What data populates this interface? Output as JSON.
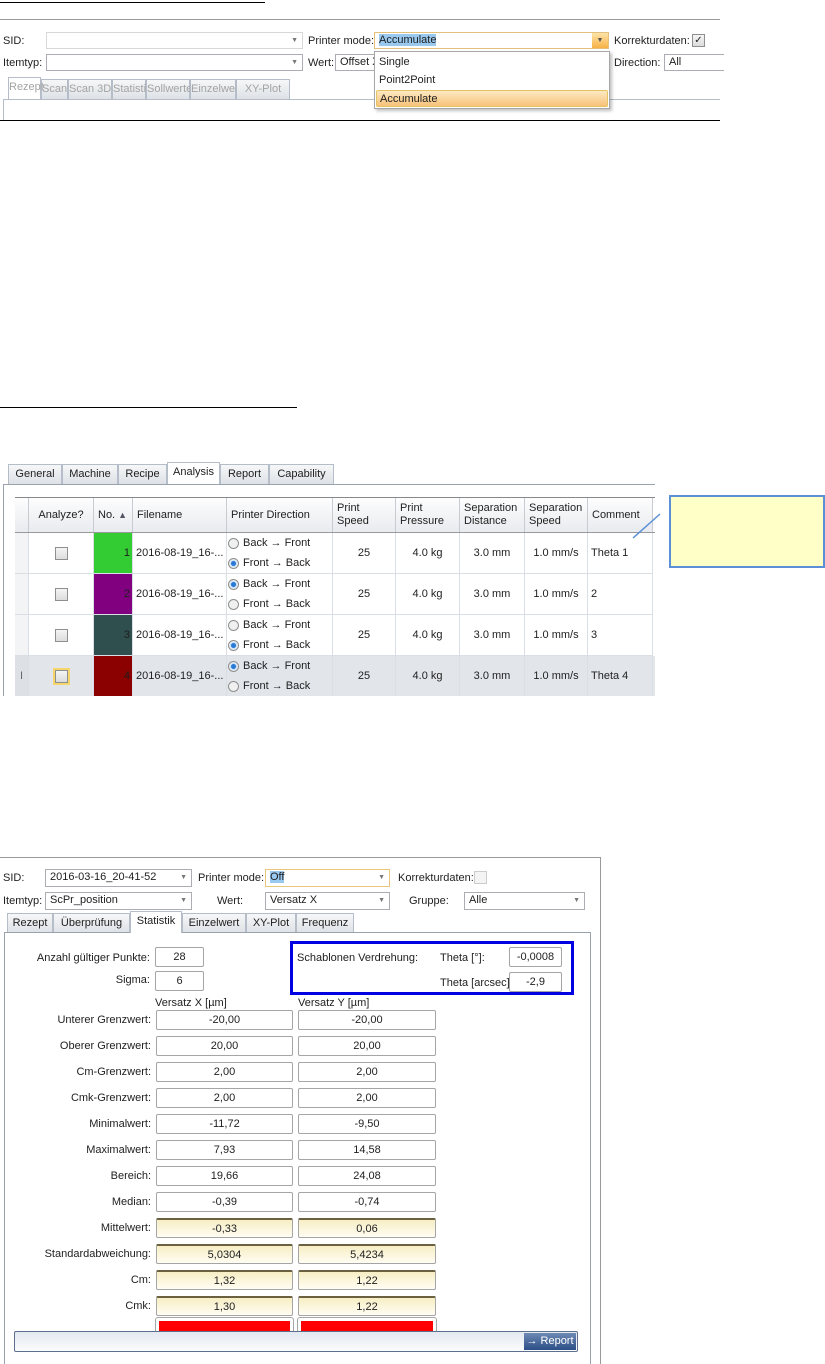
{
  "panel1": {
    "sid_label": "SID:",
    "sid_value": "",
    "printer_mode_label": "Printer mode:",
    "printer_mode_value": "Accumulate",
    "korrektur_label": "Korrekturdaten:",
    "korrektur_checked": true,
    "itemtyp_label": "Itemtyp:",
    "itemtyp_value": "",
    "wert_label": "Wert:",
    "wert_value": "Offset X",
    "direction_label": "Direction:",
    "direction_value": "All",
    "dropdown_options": [
      "Single",
      "Point2Point",
      "Accumulate"
    ],
    "tabs": [
      "Rezept",
      "Scan",
      "Scan 3D",
      "Statistik",
      "Sollwerte",
      "Einzelwert",
      "XY-Plot"
    ]
  },
  "panel2": {
    "tabs": [
      "General",
      "Machine",
      "Recipe",
      "Analysis",
      "Report",
      "Capability"
    ],
    "columns": [
      "Analyze?",
      "No.",
      "Filename",
      "Printer Direction",
      "Print Speed",
      "Print Pressure",
      "Separation Distance",
      "Separation Speed",
      "Comment"
    ],
    "direction_options": [
      "Back → Front",
      "Front → Back"
    ],
    "rows": [
      {
        "no": "1",
        "color": "#33cc33",
        "filename": "2016-08-19_16-...",
        "direction": 1,
        "speed": "25",
        "pressure": "4.0 kg",
        "distance": "3.0 mm",
        "sep_speed": "1.0 mm/s",
        "comment": "Theta 1"
      },
      {
        "no": "2",
        "color": "#800080",
        "filename": "2016-08-19_16-...",
        "direction": 0,
        "speed": "25",
        "pressure": "4.0 kg",
        "distance": "3.0 mm",
        "sep_speed": "1.0 mm/s",
        "comment": "2"
      },
      {
        "no": "3",
        "color": "#2f4f4f",
        "filename": "2016-08-19_16-...",
        "direction": 1,
        "speed": "25",
        "pressure": "4.0 kg",
        "distance": "3.0 mm",
        "sep_speed": "1.0 mm/s",
        "comment": "3"
      },
      {
        "no": "4",
        "color": "#8b0000",
        "filename": "2016-08-19_16-...",
        "direction": 0,
        "speed": "25",
        "pressure": "4.0 kg",
        "distance": "3.0 mm",
        "sep_speed": "1.0 mm/s",
        "comment": "Theta 4"
      }
    ]
  },
  "panel3": {
    "sid_label": "SID:",
    "sid_value": "2016-03-16_20-41-52",
    "printer_mode_label": "Printer mode:",
    "printer_mode_value": "Off",
    "korrektur_label": "Korrekturdaten:",
    "korrektur_checked": false,
    "itemtyp_label": "Itemtyp:",
    "itemtyp_value": "ScPr_position",
    "wert_label": "Wert:",
    "wert_value": "Versatz X",
    "gruppe_label": "Gruppe:",
    "gruppe_value": "Alle",
    "tabs": [
      "Rezept",
      "Überprüfung",
      "Statistik",
      "Einzelwert",
      "XY-Plot",
      "Frequenz"
    ],
    "anzahl_label": "Anzahl gültiger Punkte:",
    "anzahl_value": "28",
    "sigma_label": "Sigma:",
    "sigma_value": "6",
    "verdrehung_label": "Schablonen Verdrehung:",
    "theta_deg_label": "Theta [°]:",
    "theta_deg_value": "-0,0008",
    "theta_arcsec_label": "Theta [arcsec]:",
    "theta_arcsec_value": "-2,9",
    "col_x": "Versatz X [µm]",
    "col_y": "Versatz Y [µm]",
    "stats": [
      {
        "label": "Unterer Grenzwert:",
        "x": "-20,00",
        "y": "-20,00",
        "style": ""
      },
      {
        "label": "Oberer Grenzwert:",
        "x": "20,00",
        "y": "20,00",
        "style": ""
      },
      {
        "label": "Cm-Grenzwert:",
        "x": "2,00",
        "y": "2,00",
        "style": ""
      },
      {
        "label": "Cmk-Grenzwert:",
        "x": "2,00",
        "y": "2,00",
        "style": ""
      },
      {
        "label": "Minimalwert:",
        "x": "-11,72",
        "y": "-9,50",
        "style": ""
      },
      {
        "label": "Maximalwert:",
        "x": "7,93",
        "y": "14,58",
        "style": ""
      },
      {
        "label": "Bereich:",
        "x": "19,66",
        "y": "24,08",
        "style": ""
      },
      {
        "label": "Median:",
        "x": "-0,39",
        "y": "-0,74",
        "style": ""
      },
      {
        "label": "Mittelwert:",
        "x": "-0,33",
        "y": "0,06",
        "style": "y"
      },
      {
        "label": "Standardabweichung:",
        "x": "5,0304",
        "y": "5,4234",
        "style": "y"
      },
      {
        "label": "Cm:",
        "x": "1,32",
        "y": "1,22",
        "style": "y"
      },
      {
        "label": "Cmk:",
        "x": "1,30",
        "y": "1,22",
        "style": "y"
      }
    ],
    "status_color": "#ff0000",
    "report_button": "→ Report"
  }
}
